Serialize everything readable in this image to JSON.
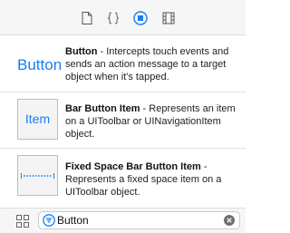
{
  "inspector_tabs": [
    {
      "icon": "file-icon"
    },
    {
      "icon": "code-braces-icon"
    },
    {
      "icon": "object-library-icon",
      "selected": true
    },
    {
      "icon": "media-library-icon"
    }
  ],
  "library": {
    "items": [
      {
        "thumb_text": "Button",
        "title": "Button",
        "description": " - Intercepts touch events and sends an action message to a target object when it's tapped."
      },
      {
        "thumb_text": "Item",
        "title": "Bar Button Item",
        "description": " - Represents an item on a UIToolbar or UINavigationItem object."
      },
      {
        "thumb_text": "",
        "title": "Fixed Space Bar Button Item",
        "description": " - Represents a fixed space item on a UIToolbar object."
      }
    ]
  },
  "filter": {
    "value": "Button",
    "filter_icon": "filter-icon",
    "clear_icon": "clear-icon",
    "view_toggle_icon": "grid-view-icon"
  },
  "colors": {
    "accent": "#1a7cf5",
    "toolbar_bg": "#f6f6f6",
    "divider": "#dcdcdc"
  }
}
